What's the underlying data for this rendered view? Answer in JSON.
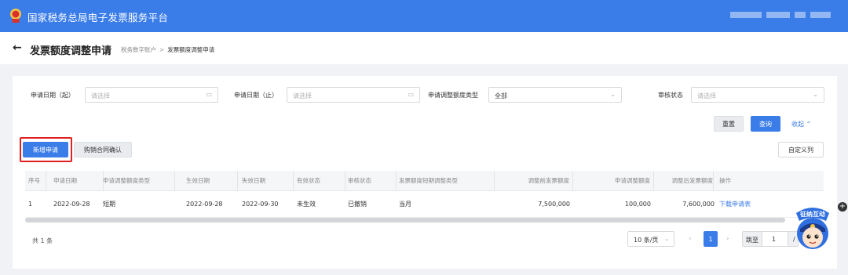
{
  "header": {
    "app_title": "国家税务总局电子发票服务平台",
    "emblem_icon": "tax-emblem-icon",
    "brand_color": "#3a7ce8"
  },
  "page": {
    "back_icon": "arrow-left-icon",
    "title": "发票额度调整申请",
    "breadcrumb": [
      "税务数字账户",
      "发票额度调整申请"
    ]
  },
  "filters": {
    "start_date": {
      "label": "申请日期（起）",
      "placeholder": "请选择"
    },
    "end_date": {
      "label": "申请日期（止）",
      "placeholder": "请选择"
    },
    "adjust_type": {
      "label": "申请调整额度类型",
      "value": "全部"
    },
    "review_status": {
      "label": "审核状态",
      "placeholder": "请选择"
    },
    "reset": "重置",
    "search": "查询",
    "collapse": "收起"
  },
  "toolbar": {
    "new_apply": "新增申请",
    "contract_confirm": "购销合同确认",
    "custom_columns": "自定义列"
  },
  "table": {
    "columns": [
      "序号",
      "申请日期",
      "申请调整额度类型",
      "生效日期",
      "失效日期",
      "有效状态",
      "审核状态",
      "发票额度短期调整类型",
      "调整前发票额度",
      "申请调整额度",
      "调整后发票额度",
      "操作"
    ],
    "rows": [
      {
        "index": "1",
        "apply_date": "2022-09-28",
        "adjust_type": "短期",
        "effective_date": "2022-09-28",
        "expire_date": "2022-09-30",
        "valid_status": "未生效",
        "review_status": "已撤销",
        "short_term_type": "当月",
        "before_amount": "7,500,000",
        "apply_amount": "100,000",
        "after_amount": "7,600,000",
        "action": "下载申请表"
      }
    ]
  },
  "pagination": {
    "total": "共 1 条",
    "page_size": "10 条/页",
    "current_page": "1",
    "jump_label": "跳至",
    "jump_value": "1",
    "slash": "/"
  },
  "widgets": {
    "mascot_label": "征纳互动",
    "plus": "+"
  }
}
